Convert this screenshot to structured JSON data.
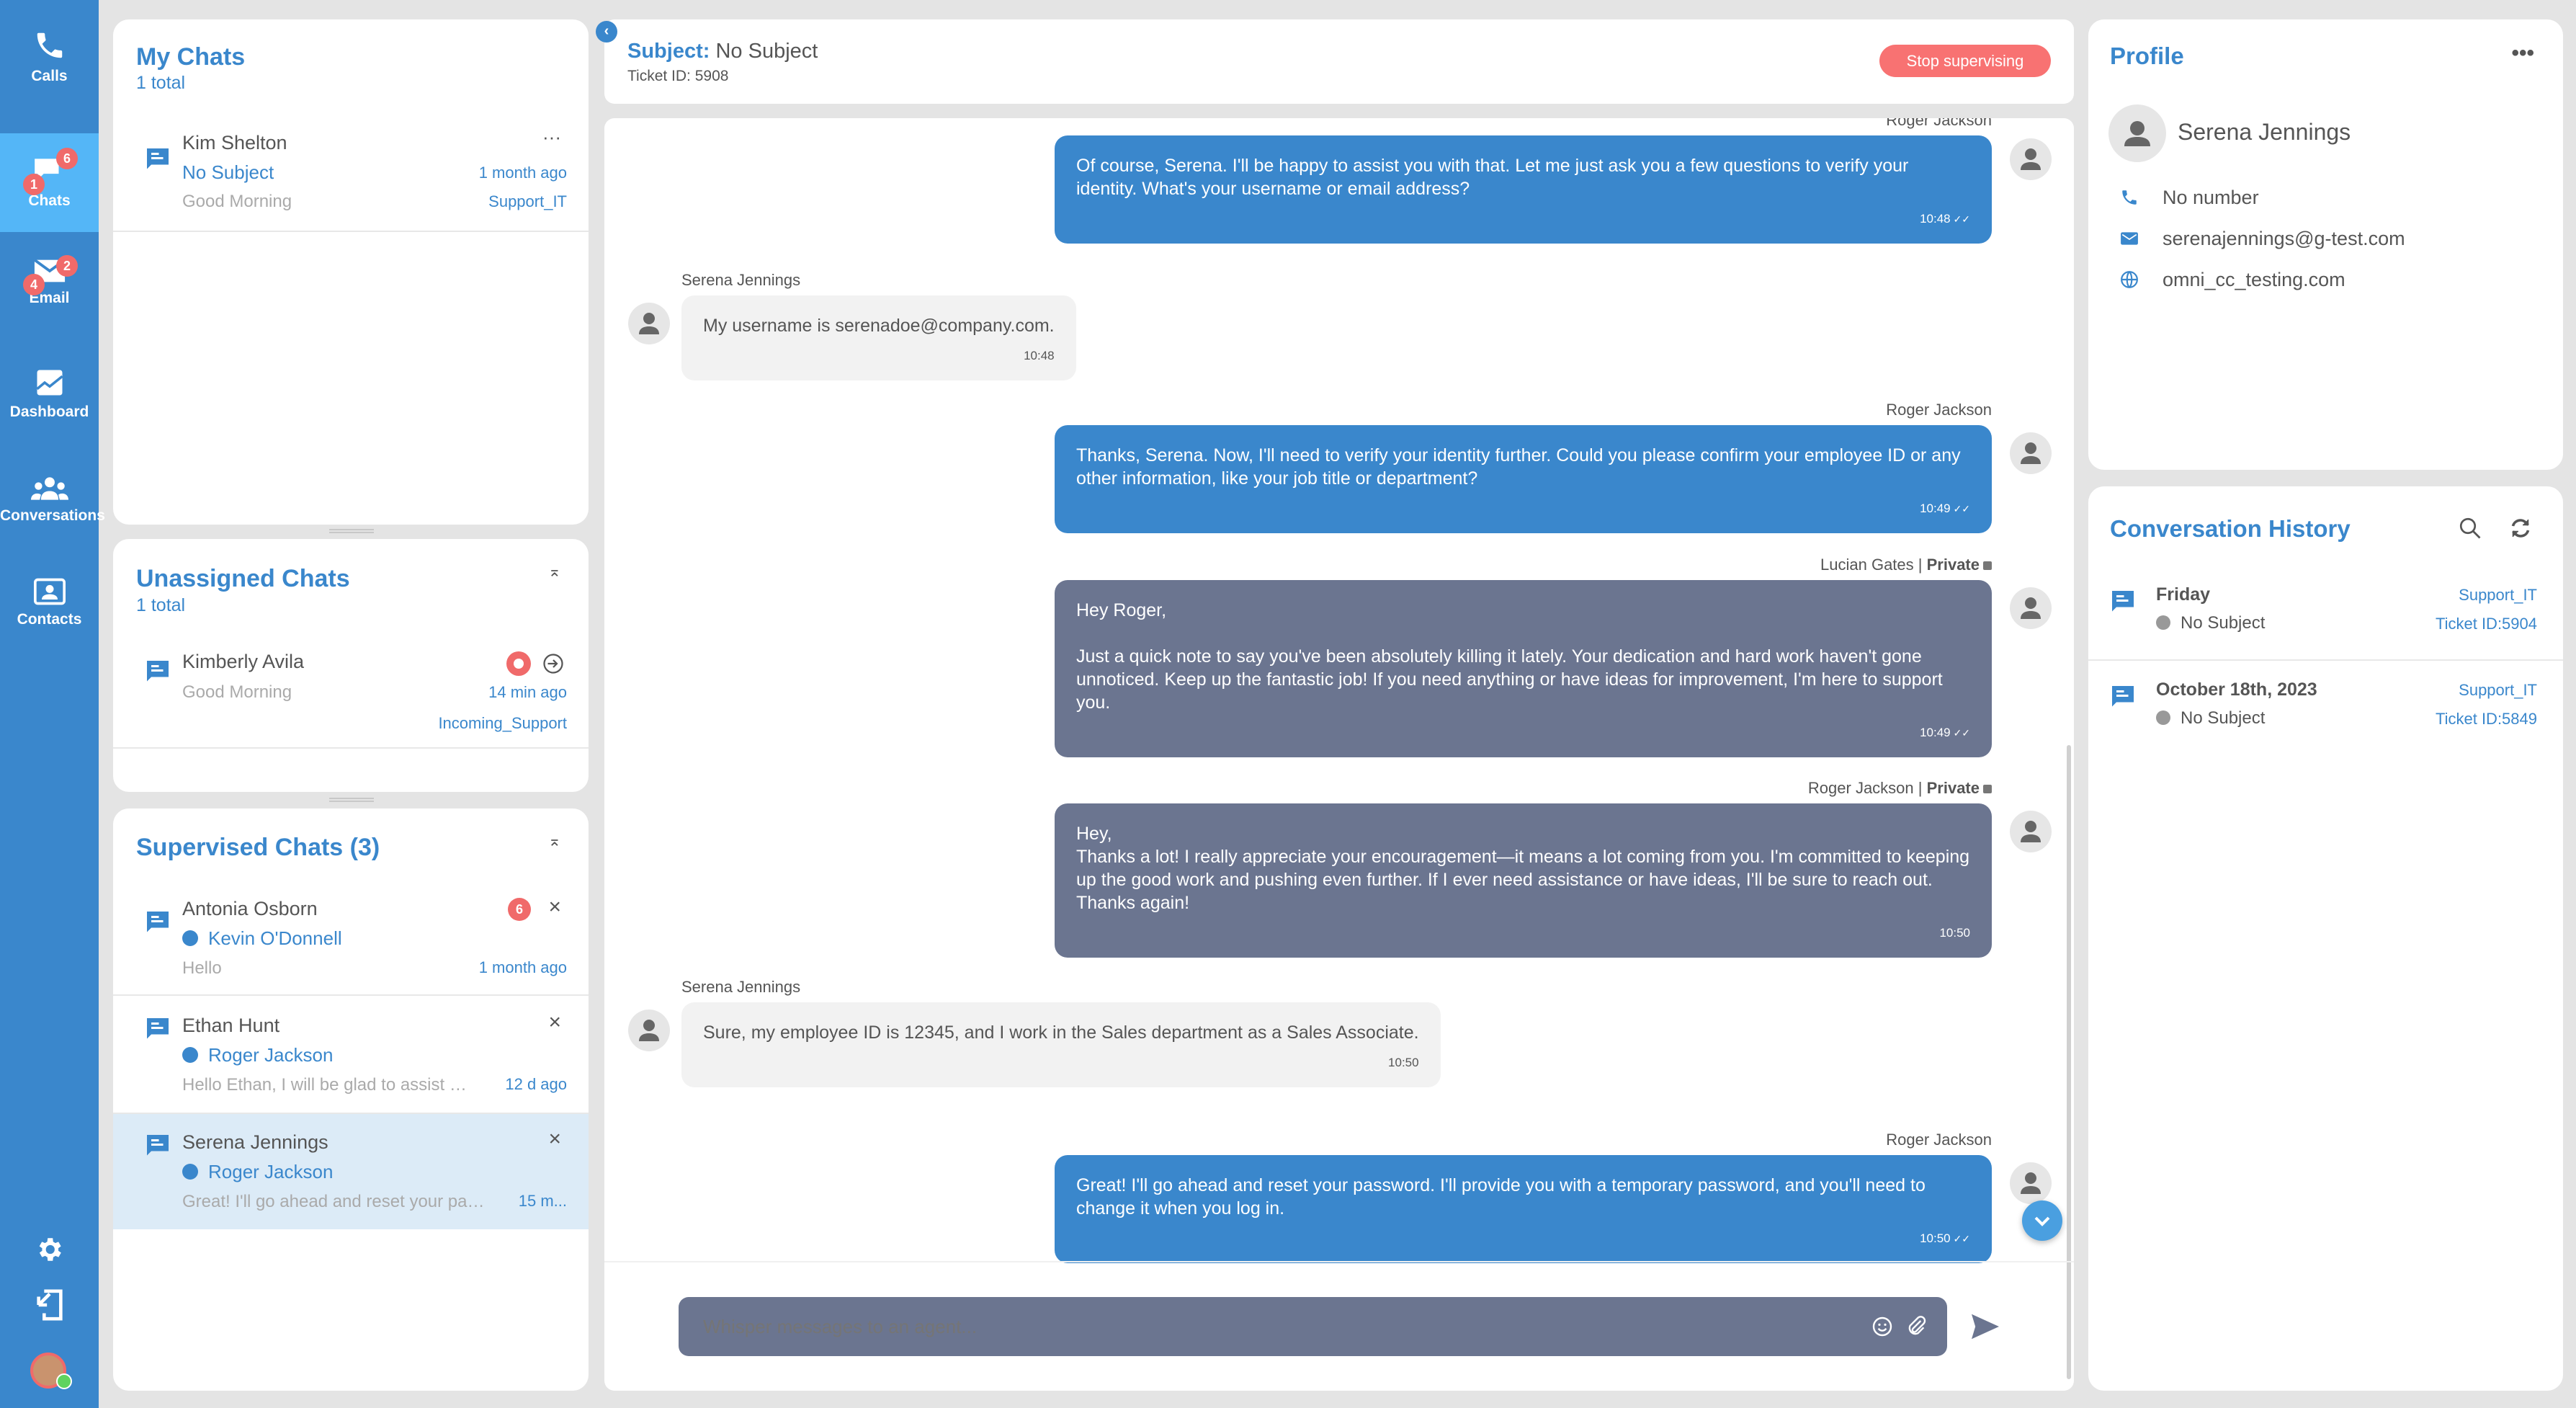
{
  "colors": {
    "primary": "#3a87cc",
    "active_nav": "#54b6f7",
    "danger": "#f87272",
    "private_bubble": "#6b7590",
    "background": "#e4e4e4"
  },
  "nav": {
    "items": [
      {
        "label": "Calls",
        "icon": "phone-icon"
      },
      {
        "label": "Chats",
        "icon": "chat-icon",
        "badge_top": "6",
        "badge_bottom": "1",
        "active": true
      },
      {
        "label": "Email",
        "icon": "email-icon",
        "badge_top": "2",
        "badge_bottom": "4"
      },
      {
        "label": "Dashboard",
        "icon": "chart-icon"
      },
      {
        "label": "Conversations",
        "icon": "group-icon"
      },
      {
        "label": "Contacts",
        "icon": "contact-card-icon"
      }
    ],
    "bottom": [
      "gear-icon",
      "logout-icon",
      "user-avatar"
    ]
  },
  "my_chats": {
    "title": "My Chats",
    "total": "1 total",
    "items": [
      {
        "name": "Kim Shelton",
        "subject": "No Subject",
        "preview": "Good Morning",
        "time": "1 month ago",
        "queue": "Support_IT",
        "menu": "···"
      }
    ]
  },
  "unassigned": {
    "title": "Unassigned Chats",
    "total": "1 total",
    "items": [
      {
        "name": "Kimberly Avila",
        "preview": "Good Morning",
        "time": "14 min ago",
        "queue": "Incoming_Support"
      }
    ]
  },
  "supervised": {
    "title": "Supervised Chats (3)",
    "items": [
      {
        "name": "Antonia Osborn",
        "agent": "Kevin O'Donnell",
        "preview": "Hello",
        "time": "1 month ago",
        "badge": "6"
      },
      {
        "name": "Ethan Hunt",
        "agent": "Roger Jackson",
        "preview": "Hello Ethan, I will be glad to assist y...",
        "time": "12 d ago"
      },
      {
        "name": "Serena Jennings",
        "agent": "Roger Jackson",
        "preview": "Great! I'll go ahead and reset your passwo...",
        "time": "15 m...",
        "selected": true
      }
    ]
  },
  "header": {
    "subject_label": "Subject:",
    "subject": "No Subject",
    "ticket": "Ticket ID: 5908",
    "stop_button": "Stop supervising"
  },
  "messages": [
    {
      "type": "agent",
      "sender": "Roger Jackson",
      "text": "Of course, Serena. I'll be happy to assist you with that. Let me just ask you a few questions to verify your identity. What's your username or email address?",
      "time": "10:48",
      "read": true
    },
    {
      "type": "customer",
      "sender": "Serena Jennings",
      "text": "My username is serenadoe@company.com.",
      "time": "10:48"
    },
    {
      "type": "agent",
      "sender": "Roger Jackson",
      "text": "Thanks, Serena. Now, I'll need to verify your identity further. Could you please confirm your employee ID or any other information, like your job title or department?",
      "time": "10:49",
      "read": true
    },
    {
      "type": "private",
      "sender": "Lucian Gates",
      "private_label": "Private",
      "text": "Hey Roger,\n\nJust a quick note to say you've been absolutely killing it lately. Your dedication and hard work haven't gone unnoticed. Keep up the fantastic job! If you need anything or have ideas for improvement, I'm here to support you.",
      "time": "10:49",
      "read": true
    },
    {
      "type": "private",
      "sender": "Roger Jackson",
      "private_label": "Private",
      "text": "Hey,\nThanks a lot! I really appreciate your encouragement—it means a lot coming from you. I'm committed to keeping up the good work and pushing even further. If I ever need assistance or have ideas, I'll be sure to reach out. Thanks again!",
      "time": "10:50"
    },
    {
      "type": "customer",
      "sender": "Serena Jennings",
      "text": "Sure, my employee ID is 12345, and I work in the Sales department as a Sales Associate.",
      "time": "10:50"
    },
    {
      "type": "agent",
      "sender": "Roger Jackson",
      "text": "Great! I'll go ahead and reset your password. I'll provide you with a temporary password, and you'll need to change it when you log in.",
      "time": "10:50",
      "read": true
    }
  ],
  "composer": {
    "placeholder": "Whisper messages to an agent..."
  },
  "profile": {
    "title": "Profile",
    "name": "Serena Jennings",
    "phone": "No number",
    "email": "serenajennings@g-test.com",
    "website": "omni_cc_testing.com"
  },
  "history": {
    "title": "Conversation History",
    "items": [
      {
        "date": "Friday",
        "subject": "No Subject",
        "queue": "Support_IT",
        "ticket": "Ticket ID:5904"
      },
      {
        "date": "October 18th, 2023",
        "subject": "No Subject",
        "queue": "Support_IT",
        "ticket": "Ticket ID:5849"
      }
    ]
  }
}
